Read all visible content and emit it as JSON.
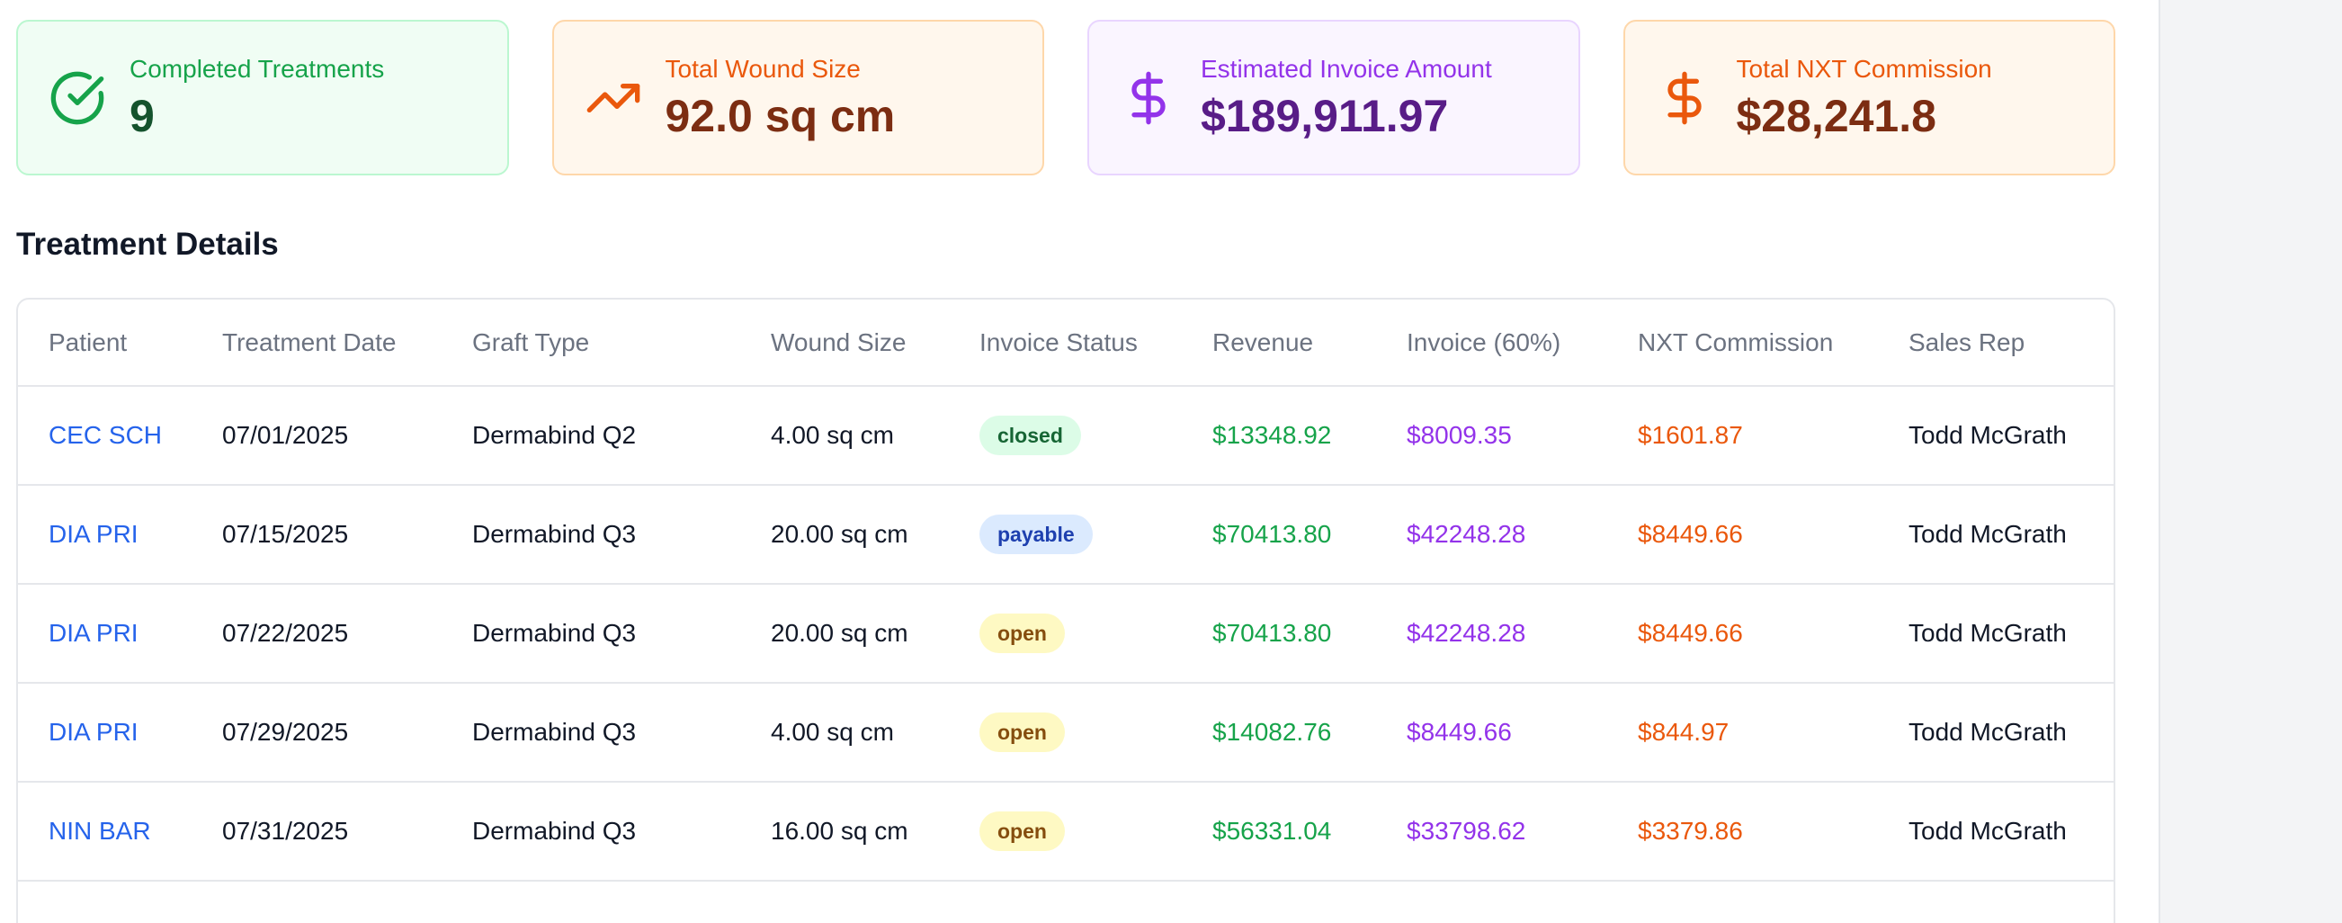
{
  "stats": [
    {
      "label": "Completed Treatments",
      "value": "9",
      "icon": "check-circle-icon"
    },
    {
      "label": "Total Wound Size",
      "value": "92.0 sq cm",
      "icon": "trending-up-icon"
    },
    {
      "label": "Estimated Invoice Amount",
      "value": "$189,911.97",
      "icon": "dollar-icon"
    },
    {
      "label": "Total NXT Commission",
      "value": "$28,241.8",
      "icon": "dollar-icon"
    }
  ],
  "section": {
    "title": "Treatment Details"
  },
  "table": {
    "headers": [
      "Patient",
      "Treatment Date",
      "Graft Type",
      "Wound Size",
      "Invoice Status",
      "Revenue",
      "Invoice (60%)",
      "NXT Commission",
      "Sales Rep"
    ],
    "rows": [
      {
        "patient": "CEC SCH",
        "date": "07/01/2025",
        "graft": "Dermabind Q2",
        "wound": "4.00 sq cm",
        "status": "closed",
        "revenue": "$13348.92",
        "invoice": "$8009.35",
        "commission": "$1601.87",
        "rep": "Todd McGrath"
      },
      {
        "patient": "DIA PRI",
        "date": "07/15/2025",
        "graft": "Dermabind Q3",
        "wound": "20.00 sq cm",
        "status": "payable",
        "revenue": "$70413.80",
        "invoice": "$42248.28",
        "commission": "$8449.66",
        "rep": "Todd McGrath"
      },
      {
        "patient": "DIA PRI",
        "date": "07/22/2025",
        "graft": "Dermabind Q3",
        "wound": "20.00 sq cm",
        "status": "open",
        "revenue": "$70413.80",
        "invoice": "$42248.28",
        "commission": "$8449.66",
        "rep": "Todd McGrath"
      },
      {
        "patient": "DIA PRI",
        "date": "07/29/2025",
        "graft": "Dermabind Q3",
        "wound": "4.00 sq cm",
        "status": "open",
        "revenue": "$14082.76",
        "invoice": "$8449.66",
        "commission": "$844.97",
        "rep": "Todd McGrath"
      },
      {
        "patient": "NIN BAR",
        "date": "07/31/2025",
        "graft": "Dermabind Q3",
        "wound": "16.00 sq cm",
        "status": "open",
        "revenue": "$56331.04",
        "invoice": "$33798.62",
        "commission": "$3379.86",
        "rep": "Todd McGrath"
      }
    ]
  },
  "colors": {
    "green": "#16a34a",
    "orange": "#ea580c",
    "purple": "#9333ea",
    "blue": "#2563eb"
  }
}
